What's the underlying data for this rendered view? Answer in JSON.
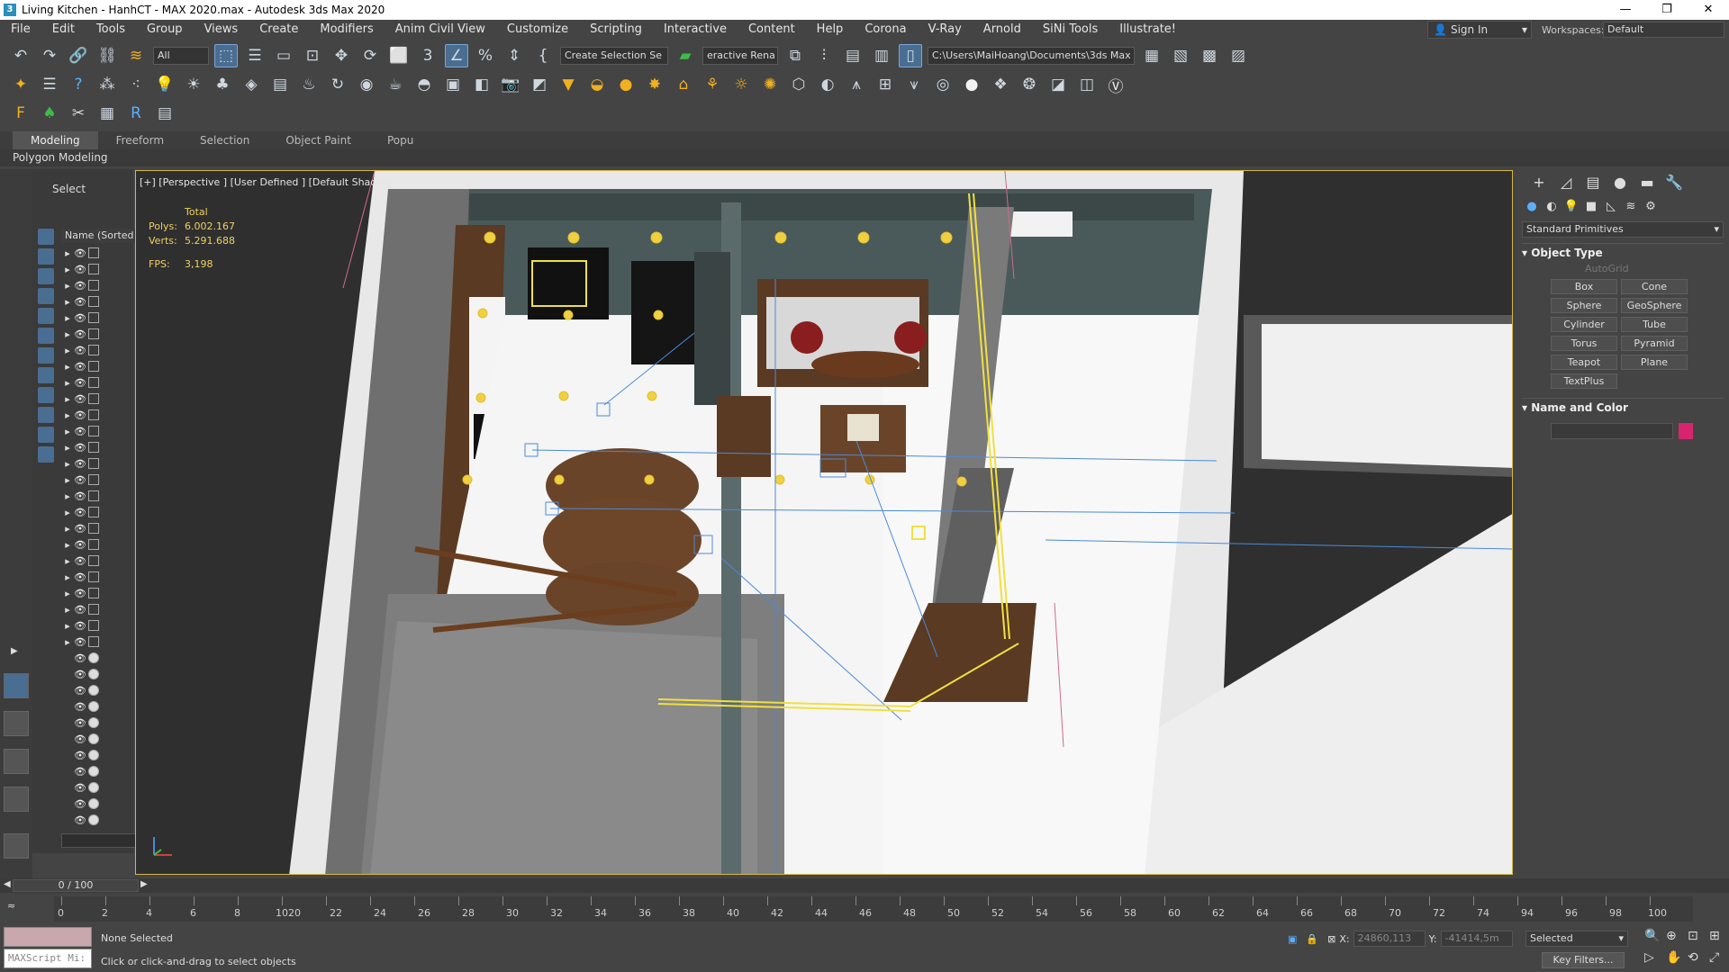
{
  "window": {
    "title": "Living Kitchen - HanhCT - MAX 2020.max - Autodesk 3ds Max 2020",
    "controls": [
      "—",
      "❐",
      "✕"
    ]
  },
  "menu": [
    "File",
    "Edit",
    "Tools",
    "Group",
    "Views",
    "Create",
    "Modifiers",
    "Anim Civil View",
    "Customize",
    "Scripting",
    "Interactive",
    "Content",
    "Help",
    "Corona",
    "V-Ray",
    "Arnold",
    "SiNi Tools",
    "Illustrate!"
  ],
  "account": {
    "sign_in": "Sign In",
    "workspaces_label": "Workspaces:",
    "workspace": "Default"
  },
  "toolbar": {
    "filter": "All",
    "selection_set": "Create Selection Se",
    "interactive_render": "eractive Rena",
    "project_path": "C:\\Users\\MaiHoang\\Documents\\3ds Max 2020"
  },
  "ribbon": {
    "tabs": [
      "Modeling",
      "Freeform",
      "Selection",
      "Object Paint",
      "Popu"
    ],
    "active_tab": "Modeling",
    "subtitle": "Polygon Modeling"
  },
  "explorer": {
    "header": "Select",
    "column": "Name (Sorted A"
  },
  "viewport": {
    "label": "[+] [Perspective ] [User Defined ] [Default Shading ]",
    "stats": {
      "total_label": "Total",
      "polys_label": "Polys:",
      "polys": "6.002.167",
      "verts_label": "Verts:",
      "verts": "5.291.688",
      "fps_label": "FPS:",
      "fps": "3,198"
    }
  },
  "command_panel": {
    "dropdown": "Standard Primitives",
    "object_type_header": "Object Type",
    "autogrid": "AutoGrid",
    "objects": [
      "Box",
      "Cone",
      "Sphere",
      "GeoSphere",
      "Cylinder",
      "Tube",
      "Torus",
      "Pyramid",
      "Teapot",
      "Plane",
      "TextPlus"
    ],
    "name_color_header": "Name and Color",
    "color": "#d6246e"
  },
  "timeline": {
    "slider": "0 / 100",
    "ticks": [
      "0",
      "2",
      "4",
      "6",
      "8",
      "1020",
      "22",
      "24",
      "26",
      "28",
      "30",
      "32",
      "34",
      "36",
      "38",
      "40",
      "42",
      "44",
      "46",
      "48",
      "50",
      "52",
      "54",
      "56",
      "58",
      "60",
      "62",
      "64",
      "66",
      "68",
      "70",
      "72",
      "74",
      "94",
      "96",
      "98",
      "100"
    ]
  },
  "status": {
    "maxscript": "MAXScript Mi:",
    "selection": "None Selected",
    "hint": "Click or click-and-drag to select objects",
    "x_label": "X:",
    "x": "24860,113",
    "y_label": "Y:",
    "y": "-41414,5m",
    "selected_dropdown": "Selected",
    "key_filters": "Key Filters..."
  }
}
